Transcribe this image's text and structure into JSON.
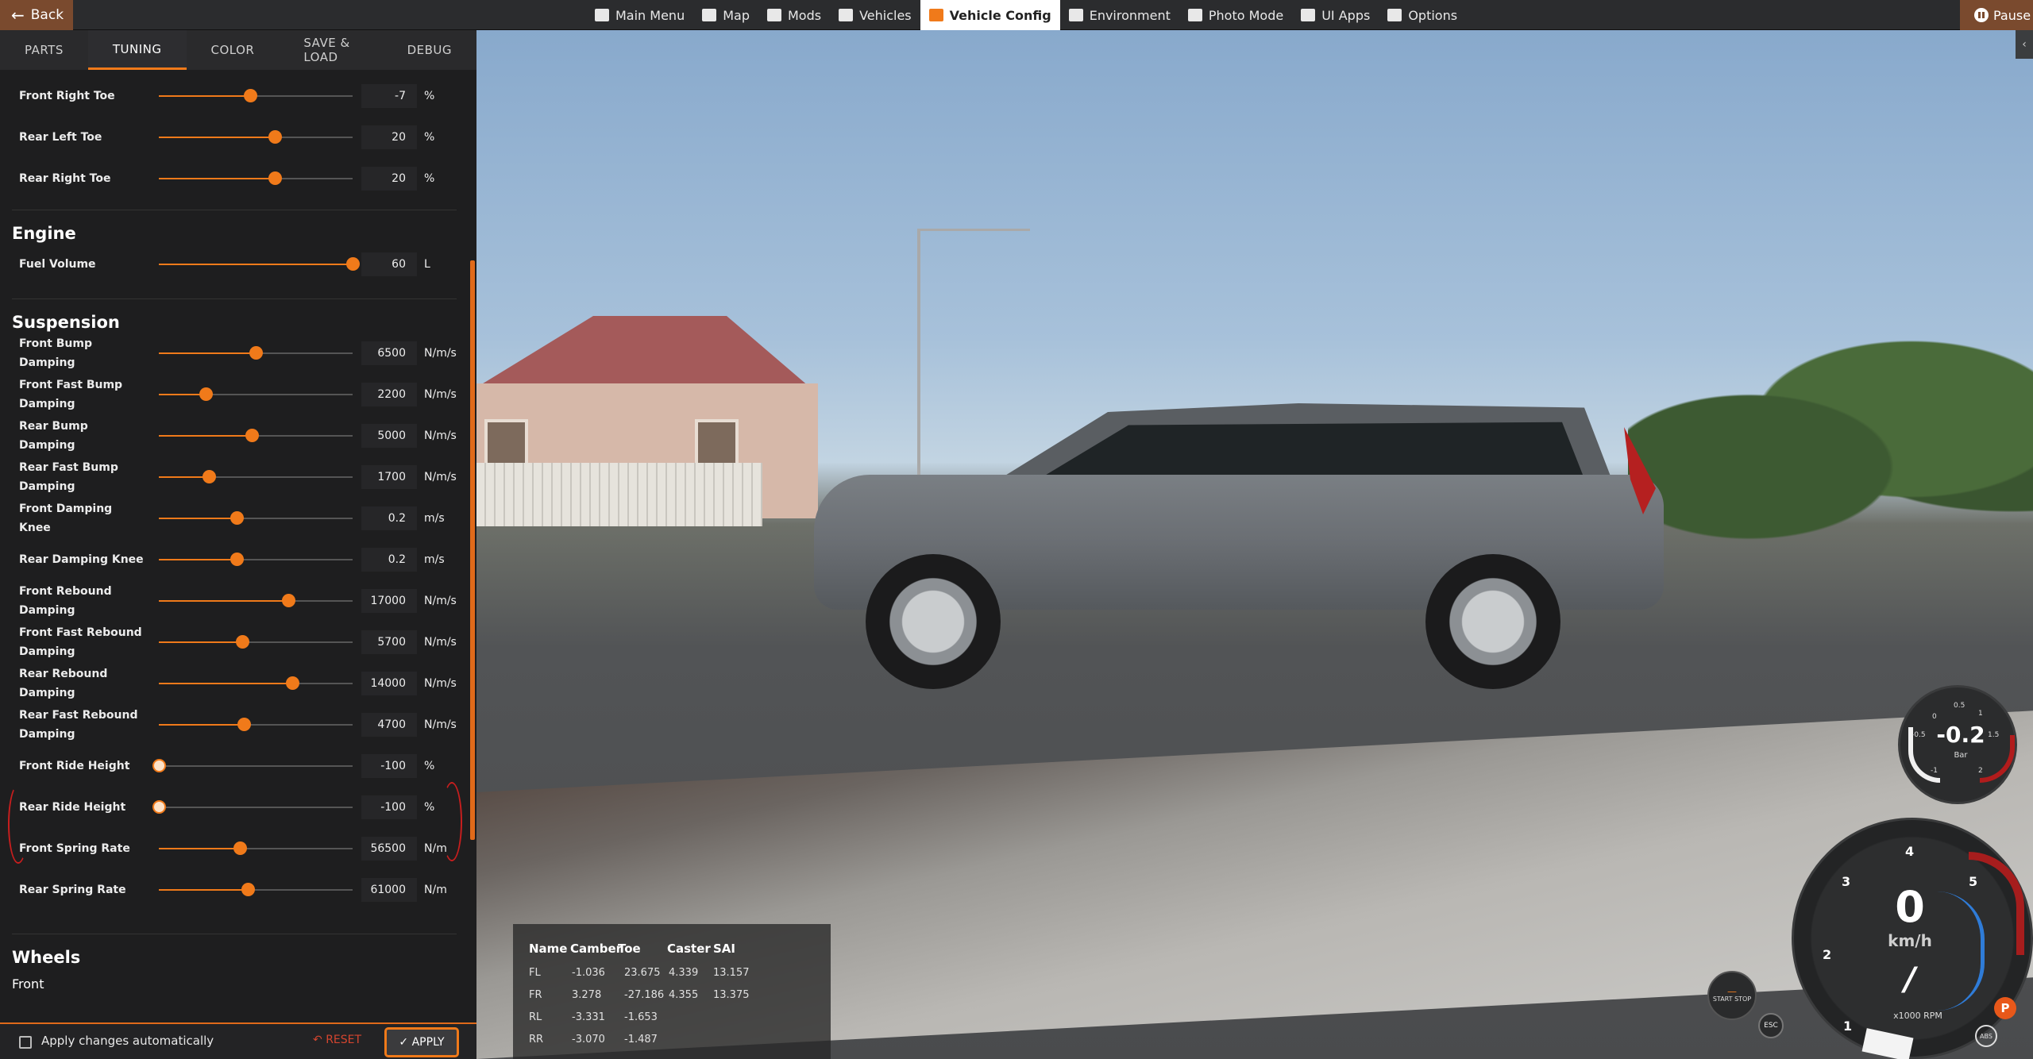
{
  "topbar": {
    "back_label": "Back",
    "pause_label": "Pause",
    "nav": [
      {
        "label": "Main Menu",
        "icon": "main-menu-icon"
      },
      {
        "label": "Map",
        "icon": "map-icon"
      },
      {
        "label": "Mods",
        "icon": "puzzle-icon"
      },
      {
        "label": "Vehicles",
        "icon": "car-icon"
      },
      {
        "label": "Vehicle Config",
        "icon": "vehicle-config-icon",
        "active": true
      },
      {
        "label": "Environment",
        "icon": "weather-icon"
      },
      {
        "label": "Photo Mode",
        "icon": "camera-icon"
      },
      {
        "label": "UI Apps",
        "icon": "ui-apps-icon"
      },
      {
        "label": "Options",
        "icon": "sliders-icon"
      }
    ]
  },
  "panel": {
    "tabs": [
      "PARTS",
      "TUNING",
      "COLOR",
      "SAVE & LOAD",
      "DEBUG"
    ],
    "active_tab": "TUNING",
    "toe_rows": [
      {
        "label": "Front Right Toe",
        "value": "-7",
        "unit": "%",
        "fraction": 0.47
      },
      {
        "label": "Rear Left Toe",
        "value": "20",
        "unit": "%",
        "fraction": 0.6
      },
      {
        "label": "Rear Right Toe",
        "value": "20",
        "unit": "%",
        "fraction": 0.6
      }
    ],
    "engine_title": "Engine",
    "engine_rows": [
      {
        "label": "Fuel Volume",
        "value": "60",
        "unit": "L",
        "fraction": 1.0
      }
    ],
    "suspension_title": "Suspension",
    "suspension_rows": [
      {
        "label": "Front Bump Damping",
        "value": "6500",
        "unit": "N/m/s",
        "fraction": 0.5
      },
      {
        "label": "Front Fast Bump Damping",
        "value": "2200",
        "unit": "N/m/s",
        "fraction": 0.24
      },
      {
        "label": "Rear Bump Damping",
        "value": "5000",
        "unit": "N/m/s",
        "fraction": 0.48
      },
      {
        "label": "Rear Fast Bump Damping",
        "value": "1700",
        "unit": "N/m/s",
        "fraction": 0.26
      },
      {
        "label": "Front Damping Knee",
        "value": "0.2",
        "unit": "m/s",
        "fraction": 0.4
      },
      {
        "label": "Rear Damping Knee",
        "value": "0.2",
        "unit": "m/s",
        "fraction": 0.4
      },
      {
        "label": "Front Rebound Damping",
        "value": "17000",
        "unit": "N/m/s",
        "fraction": 0.67
      },
      {
        "label": "Front Fast Rebound Damping",
        "value": "5700",
        "unit": "N/m/s",
        "fraction": 0.43
      },
      {
        "label": "Rear Rebound Damping",
        "value": "14000",
        "unit": "N/m/s",
        "fraction": 0.69
      },
      {
        "label": "Rear Fast Rebound Damping",
        "value": "4700",
        "unit": "N/m/s",
        "fraction": 0.44
      },
      {
        "label": "Front Ride Height",
        "value": "-100",
        "unit": "%",
        "fraction": 0.0
      },
      {
        "label": "Rear Ride Height",
        "value": "-100",
        "unit": "%",
        "fraction": 0.0
      },
      {
        "label": "Front Spring Rate",
        "value": "56500",
        "unit": "N/m",
        "fraction": 0.42
      },
      {
        "label": "Rear Spring Rate",
        "value": "61000",
        "unit": "N/m",
        "fraction": 0.46
      }
    ],
    "wheels_title": "Wheels",
    "wheels_sub": "Front",
    "auto_apply_label": "Apply changes automatically",
    "reset_label": "RESET",
    "apply_label": "APPLY"
  },
  "alignment": {
    "headers": [
      "Name",
      "Camber",
      "Toe",
      "Caster",
      "SAI"
    ],
    "rows": [
      [
        "FL",
        "-1.036",
        "23.675",
        "4.339",
        "13.157"
      ],
      [
        "FR",
        "3.278",
        "-27.186",
        "4.355",
        "13.375"
      ],
      [
        "RL",
        "-3.331",
        "-1.653",
        "",
        ""
      ],
      [
        "RR",
        "-3.070",
        "-1.487",
        "",
        ""
      ]
    ]
  },
  "hud": {
    "boost_value": "-0.2",
    "boost_unit": "Bar",
    "boost_ticks": [
      "-0.5",
      "0",
      "0.5",
      "1",
      "1.5",
      "2",
      "-1"
    ],
    "speed_value": "0",
    "speed_unit": "km/h",
    "gear": "/",
    "rpm_label": "x1000 RPM",
    "rpm_ticks": [
      "1",
      "2",
      "3",
      "4",
      "5"
    ],
    "start_stop_label": "START STOP",
    "esc_label": "ESC",
    "park_label": "P",
    "abs_label": "ABS"
  },
  "colors": {
    "accent": "#f07a1a",
    "panel_bg": "#1e1e1f",
    "topbar_bg": "#2b2c2e",
    "annotation": "#c81e1e"
  }
}
